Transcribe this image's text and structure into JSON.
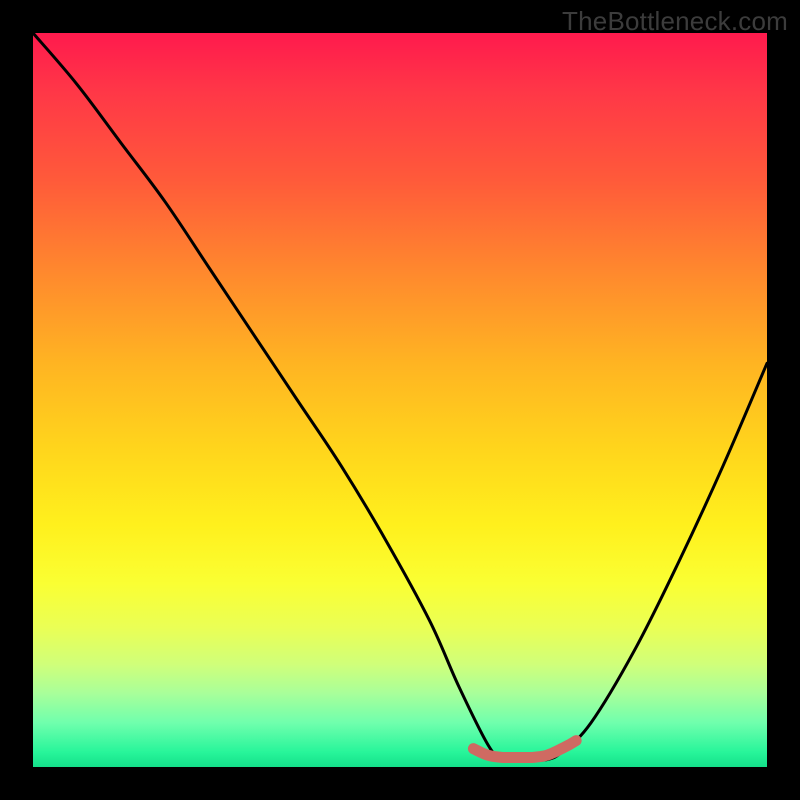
{
  "watermark": "TheBottleneck.com",
  "chart_data": {
    "type": "line",
    "title": "",
    "xlabel": "",
    "ylabel": "",
    "xlim": [
      0,
      100
    ],
    "ylim": [
      0,
      100
    ],
    "series": [
      {
        "name": "curve",
        "x": [
          0,
          6,
          12,
          18,
          24,
          30,
          36,
          42,
          48,
          54,
          58,
          62,
          64,
          66,
          68,
          70,
          72,
          76,
          82,
          88,
          94,
          100
        ],
        "y": [
          100,
          93,
          85,
          77,
          68,
          59,
          50,
          41,
          31,
          20,
          11,
          3,
          1,
          1,
          1,
          1,
          2,
          6,
          16,
          28,
          41,
          55
        ]
      },
      {
        "name": "marker-band",
        "x": [
          60,
          61,
          62,
          63,
          64,
          65,
          66,
          67,
          68,
          69,
          70,
          71,
          72,
          73,
          74
        ],
        "y": [
          2.5,
          2.0,
          1.6,
          1.4,
          1.3,
          1.3,
          1.3,
          1.3,
          1.3,
          1.4,
          1.6,
          2.0,
          2.5,
          3.0,
          3.6
        ]
      }
    ],
    "colors": {
      "curve": "#000000",
      "marker": "#cf6a62",
      "gradient_top": "#ff1a4d",
      "gradient_bottom": "#14e08a"
    }
  }
}
